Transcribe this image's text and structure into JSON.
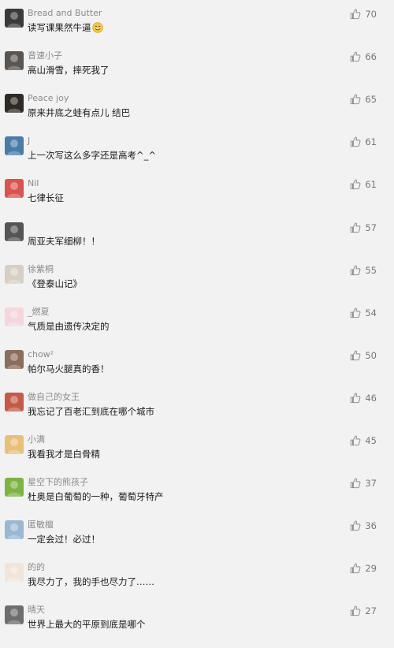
{
  "comments": [
    {
      "user": "Bread and Butter",
      "text": "读写课果然牛逼",
      "emoji": "smile-emoji",
      "likes": "70",
      "avatar_color": "#3a3a3a"
    },
    {
      "user": "音速小子",
      "text": "高山滑雪，摔死我了",
      "likes": "66",
      "avatar_color": "#5a5550"
    },
    {
      "user": "Peace joy",
      "text": "原来井底之蛙有点儿 结巴",
      "likes": "65",
      "avatar_color": "#2e2a26"
    },
    {
      "user": "J",
      "text": "上一次写这么多字还是高考^_^",
      "likes": "61",
      "avatar_color": "#4a7ca8"
    },
    {
      "user": "Nil",
      "text": "七律长征",
      "likes": "61",
      "avatar_color": "#d9534f"
    },
    {
      "user": "",
      "text": "周亚夫军细柳！！",
      "likes": "57",
      "avatar_color": "#555555"
    },
    {
      "user": "徐紫桐",
      "text": "《登泰山记》",
      "likes": "55",
      "avatar_color": "#d8cfc4"
    },
    {
      "user": "_燃夏",
      "text": "气质是由遗传决定的",
      "likes": "54",
      "avatar_color": "#f4d6dc"
    },
    {
      "user": "chow²",
      "text": "帕尔马火腿真的香！",
      "likes": "50",
      "avatar_color": "#8a6d5a"
    },
    {
      "user": "做自己的女王",
      "text": "我忘记了百老汇到底在哪个城市",
      "likes": "46",
      "avatar_color": "#c45a4a"
    },
    {
      "user": "小满",
      "text": "我看我才是白骨精",
      "likes": "45",
      "avatar_color": "#e8c07a"
    },
    {
      "user": "星空下的熊孩子",
      "text": "杜奥是白葡萄的一种，葡萄牙特产",
      "likes": "37",
      "avatar_color": "#7cb342"
    },
    {
      "user": "匿敏檀",
      "text": "一定会过！必过！",
      "likes": "36",
      "avatar_color": "#9bb8d3"
    },
    {
      "user": "的的",
      "text": "我尽力了，我的手也尽力了……",
      "likes": "29",
      "avatar_color": "#f1e4d8"
    },
    {
      "user": "晴天",
      "text": "世界上最大的平原到底是哪个",
      "likes": "27",
      "avatar_color": "#6d6d6d"
    }
  ],
  "like_icon": "thumbs-up-icon",
  "colors": {
    "background": "#f2f2f2",
    "username": "#8a8a8a",
    "text": "#1a1a1a",
    "like": "#777777"
  }
}
